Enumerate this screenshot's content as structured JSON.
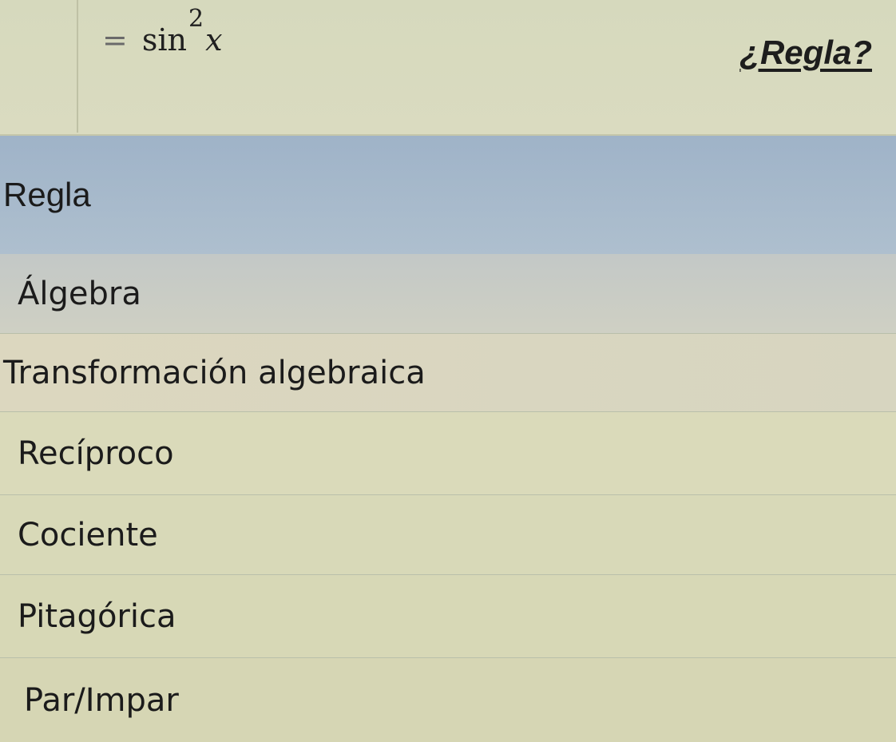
{
  "equation": {
    "equals": "=",
    "function": "sin",
    "exponent": "2",
    "variable": "x"
  },
  "rule_link": "¿Regla?",
  "dropdown": {
    "options": [
      {
        "label": "Regla",
        "selected": true
      },
      {
        "label": "Álgebra",
        "selected": false
      },
      {
        "label": "Transformación algebraica",
        "selected": false
      },
      {
        "label": "Recíproco",
        "selected": false
      },
      {
        "label": "Cociente",
        "selected": false
      },
      {
        "label": "Pitagórica",
        "selected": false
      },
      {
        "label": "Par/Impar",
        "selected": false
      }
    ]
  },
  "colors": {
    "selected_highlight": "#a8bacd",
    "list_background": "#dadaba"
  }
}
